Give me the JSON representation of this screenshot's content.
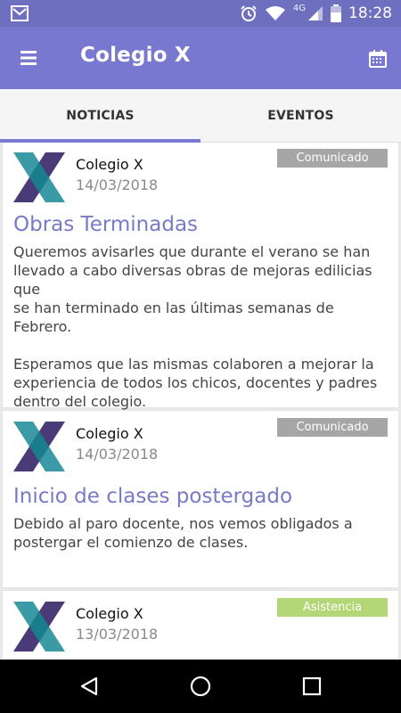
{
  "status_bar": {
    "network_label": "4G",
    "time": "18:28"
  },
  "app_bar": {
    "title": "Colegio X"
  },
  "tabs": [
    {
      "label": "NOTICIAS",
      "selected": true
    },
    {
      "label": "EVENTOS",
      "selected": false
    }
  ],
  "posts": [
    {
      "org": "Colegio X",
      "date": "14/03/2018",
      "badge": "Comunicado",
      "badge_color": "#a6a6a6",
      "title": "Obras Terminadas",
      "body_lines": [
        "Queremos avisarles que durante el verano se han",
        "llevado a cabo diversas obras de mejoras edilicias que",
        "se han terminado en las últimas semanas de Febrero.",
        "",
        "Esperamos que las mismas colaboren a mejorar la",
        "experiencia de todos los chicos, docentes y padres",
        "dentro del colegio."
      ]
    },
    {
      "org": "Colegio X",
      "date": "14/03/2018",
      "badge": "Comunicado",
      "badge_color": "#a6a6a6",
      "title": "Inicio de clases postergado",
      "body_lines": [
        "Debido al paro docente, nos vemos obligados a",
        "postergar el comienzo de clases."
      ]
    },
    {
      "org": "Colegio X",
      "date": "13/03/2018",
      "badge": "Asistencia",
      "badge_color": "#b3d676",
      "title": "",
      "body_lines": []
    }
  ],
  "colors": {
    "status_bar": "#6f6fbf",
    "app_bar": "#7878d0",
    "accent": "#7a7ad0",
    "title_text": "#7979c8"
  },
  "icons": {
    "status_left": "mail-icon",
    "alarm": "alarm-icon",
    "wifi": "wifi-icon",
    "signal": "signal-icon",
    "battery": "battery-icon",
    "menu": "hamburger-menu-icon",
    "calendar": "calendar-icon",
    "back": "back-triangle-icon",
    "home": "home-circle-icon",
    "recents": "recents-square-icon"
  }
}
